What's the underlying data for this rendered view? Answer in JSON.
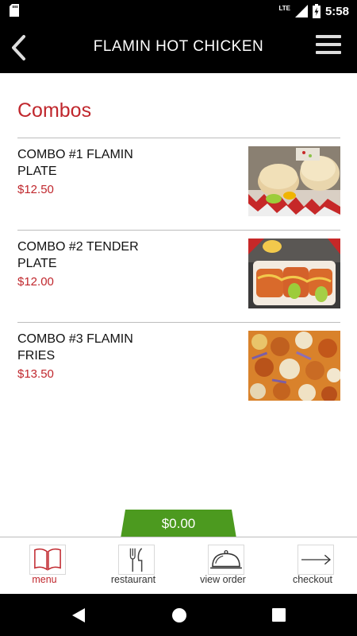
{
  "status_bar": {
    "network": "LTE",
    "time": "5:58"
  },
  "app_bar": {
    "title": "FLAMIN HOT CHICKEN",
    "back_icon": "chevron-left-icon",
    "menu_icon": "hamburger-menu-icon"
  },
  "section": {
    "title": "Combos"
  },
  "items": [
    {
      "name": "COMBO #1 FLAMIN PLATE",
      "price": "$12.50",
      "image": "sliders-food-photo"
    },
    {
      "name": "COMBO #2 TENDER PLATE",
      "price": "$12.00",
      "image": "tenders-food-photo"
    },
    {
      "name": "COMBO #3 FLAMIN FRIES",
      "price": "$13.50",
      "image": "loaded-fries-food-photo"
    }
  ],
  "cart": {
    "total": "$0.00"
  },
  "bottom_nav": [
    {
      "label": "menu",
      "icon": "book-icon",
      "active": true
    },
    {
      "label": "restaurant",
      "icon": "fork-knife-icon",
      "active": false
    },
    {
      "label": "view order",
      "icon": "cloche-icon",
      "active": false
    },
    {
      "label": "checkout",
      "icon": "arrow-right-icon",
      "active": false
    }
  ],
  "colors": {
    "accent": "#c0272d",
    "cart_green": "#4c9a1f",
    "header": "#000000"
  }
}
